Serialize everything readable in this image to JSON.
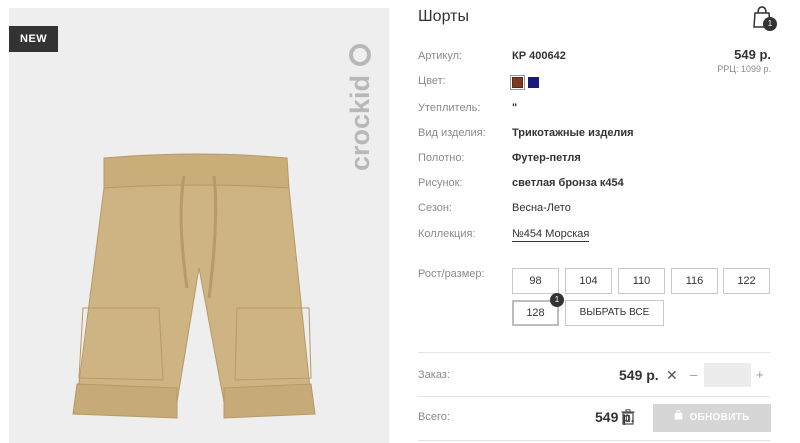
{
  "image": {
    "badge": "NEW",
    "brand": "crockid"
  },
  "product": {
    "title": "Шорты",
    "price": "549 р.",
    "rrp": "РРЦ: 1099 р."
  },
  "cart": {
    "count": "1"
  },
  "specs": [
    {
      "label": "Артикул:",
      "value": "КР 400642"
    },
    {
      "label": "Цвет:",
      "value": ""
    },
    {
      "label": "Утеплитель:",
      "value": "\""
    },
    {
      "label": "Вид изделия:",
      "value": "Трикотажные изделия"
    },
    {
      "label": "Полотно:",
      "value": "Футер-петля"
    },
    {
      "label": "Рисунок:",
      "value": "светлая бронза к454"
    },
    {
      "label": "Сезон:",
      "value": "Весна-Лето"
    },
    {
      "label": "Коллекция:",
      "value": "№454 Морская"
    }
  ],
  "colors": [
    "#7a3b22",
    "#1a1a7a"
  ],
  "sizes": {
    "label": "Рост/размер:",
    "options": [
      "98",
      "104",
      "110",
      "116",
      "122",
      "128"
    ],
    "selected": "128",
    "selected_count": "1",
    "select_all": "ВЫБРАТЬ ВСЕ"
  },
  "order": {
    "label": "Заказ:",
    "price": "549 р.",
    "times": "✕",
    "minus": "–",
    "plus": "+",
    "quantity": ""
  },
  "total": {
    "label": "Всего:",
    "price": "549 р.",
    "button": "ОБНОВИТЬ"
  }
}
